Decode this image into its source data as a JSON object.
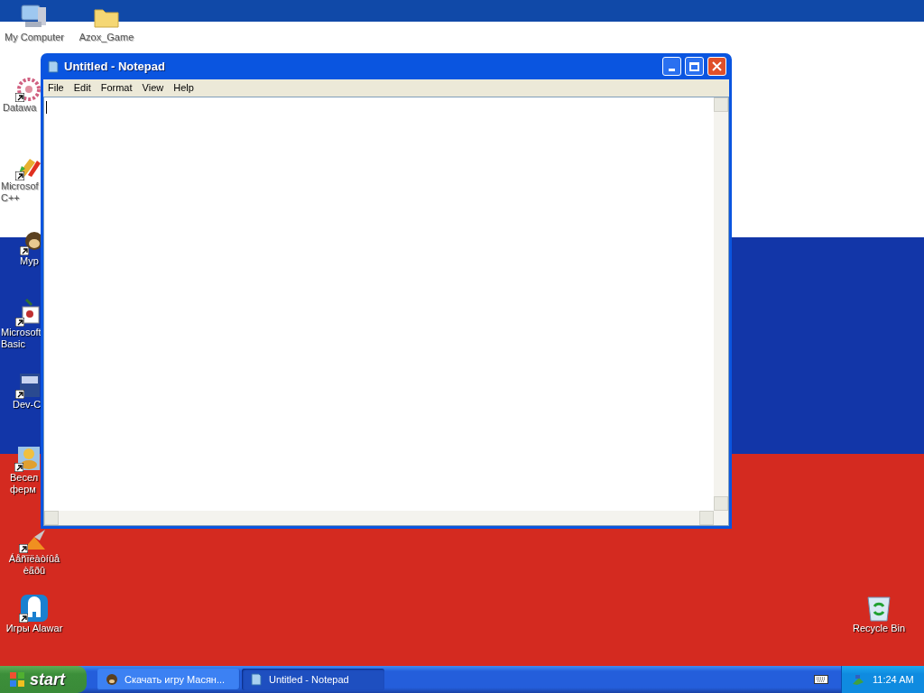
{
  "desktop_icons": [
    {
      "kind": "computer",
      "lines": [
        "My Computer"
      ]
    },
    {
      "kind": "folder",
      "lines": [
        "Azox_Game"
      ]
    },
    {
      "kind": "flower",
      "lines": [
        "Datawa"
      ]
    },
    {
      "kind": "pencils",
      "lines": [
        "Microsof",
        "C++"
      ]
    },
    {
      "kind": "monkey",
      "lines": [
        "Myp"
      ]
    },
    {
      "kind": "sprout",
      "lines": [
        "Microsoft",
        "Basic"
      ]
    },
    {
      "kind": "dev",
      "lines": [
        "Dev-C"
      ]
    },
    {
      "kind": "duck",
      "lines": [
        "Весел",
        "ферм"
      ]
    },
    {
      "kind": "bird",
      "lines": [
        "Áåñïëàòíûå",
        "èãðû"
      ]
    },
    {
      "kind": "alawar",
      "lines": [
        "Игры Alawar"
      ]
    },
    {
      "kind": "recycle",
      "lines": [
        "Recycle Bin"
      ]
    }
  ],
  "window": {
    "title": "Untitled - Notepad",
    "menu": [
      "File",
      "Edit",
      "Format",
      "View",
      "Help"
    ]
  },
  "taskbar": {
    "start": "start",
    "tasks": [
      {
        "label": "Скачать игру Масян...",
        "selected": false
      },
      {
        "label": "Untitled - Notepad",
        "selected": true
      }
    ],
    "clock": "11:24 AM"
  }
}
